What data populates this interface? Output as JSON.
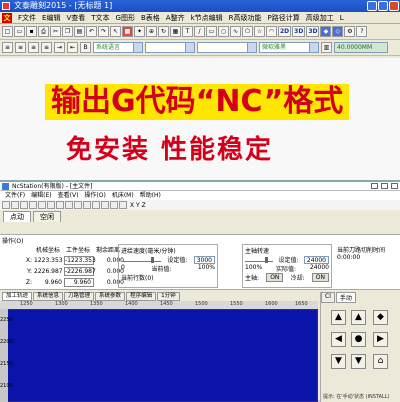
{
  "window1": {
    "title": "文泰雕刻2015 - [无标题 1]",
    "menu": [
      "F文件",
      "E编辑",
      "V查看",
      "T文本",
      "G图形",
      "B表格",
      "A整齐",
      "k节点编辑",
      "R高级功能",
      "P路径计算",
      "高级加工",
      "L"
    ],
    "toolbar_labels": [
      "2D",
      "3D",
      "3D"
    ],
    "lang_combo": "系统语言",
    "font_combo": "微软雅黑",
    "size_value": "40.0000MM"
  },
  "banner": {
    "line1": "输出G代码“NC”格式",
    "line2": "免安装   性能稳定"
  },
  "window2": {
    "title": "NcStation(有限版) - [主文件]",
    "menu": [
      "文件(F)",
      "编辑(E)",
      "查看(V)",
      "操作(O)",
      "机床(M)",
      "帮助(H)"
    ],
    "toolbar_axis": "X   Y   Z",
    "tabs": [
      "点动",
      "空闲"
    ],
    "status_header": "操作(O)",
    "axis_headers": [
      "机械坐标",
      "工件坐标",
      "剩余距离"
    ],
    "axes": [
      {
        "name": "X:",
        "mech": "1223.353",
        "work": "-1223.353",
        "remain": "0.000"
      },
      {
        "name": "Y:",
        "mech": "2226.987",
        "work": "-2226.987",
        "remain": "0.000"
      },
      {
        "name": "Z:",
        "mech": "9.960",
        "work": "9.960",
        "remain": "0.000"
      }
    ],
    "feed": {
      "title": "进给速度(毫米/分钟)",
      "set_label": "设定值:",
      "set_value": "3000",
      "actual_label": "当前值:",
      "pct": "100%",
      "pct2": "0",
      "current_label": "当前行数(0)"
    },
    "spindle": {
      "title": "主轴转速",
      "set_label": "设定值:",
      "set_value": "24000",
      "actual_label": "实际值:",
      "actual_value": "24000",
      "pct": "100%",
      "on_label": "主轴:",
      "on_value": "ON",
      "cool_label": "冷却:",
      "cool_value": "ON"
    },
    "right_panel": {
      "line1": "当前刀路切削时间",
      "line2": "0:00:00"
    },
    "lower_tabs": [
      "加工轨迹",
      "系统信息",
      "刀路管理",
      "系统参数",
      "程序编辑",
      "1分钟"
    ],
    "ruler_ticks": [
      "1250",
      "1300",
      "1350",
      "1400",
      "1450",
      "1500",
      "1550",
      "1600",
      "1650"
    ],
    "vruler_ticks": [
      "2250",
      "2200",
      "2150",
      "2100"
    ],
    "jog": {
      "tabs": [
        "Cl",
        "手动"
      ],
      "note": "提示: 在'手动'状态 (INSTALL)"
    }
  }
}
